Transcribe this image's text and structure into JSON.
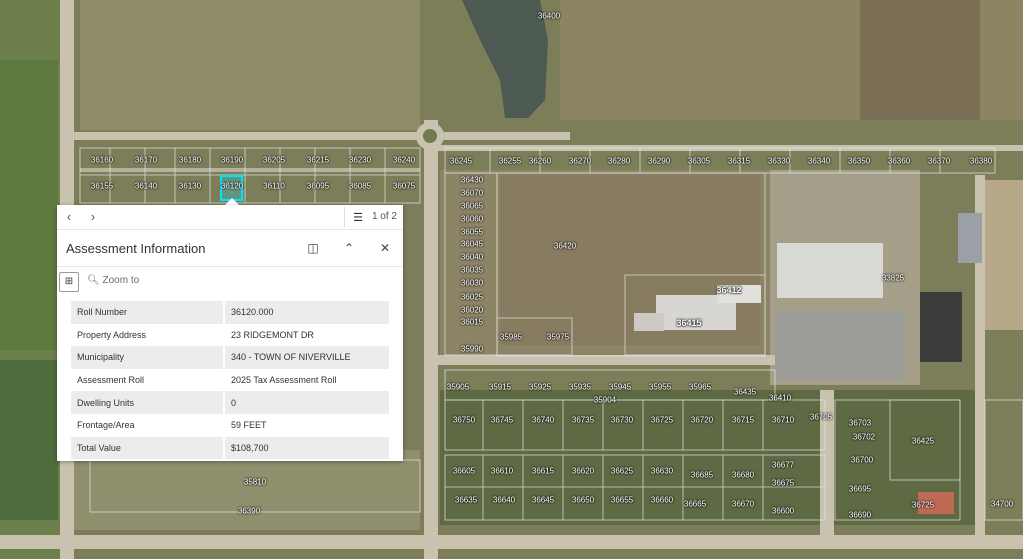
{
  "map": {
    "parcels": [
      "36400",
      "36160",
      "36170",
      "36180",
      "36190",
      "36205",
      "36215",
      "36230",
      "36240",
      "36155",
      "36140",
      "36130",
      "36120",
      "36110",
      "36095",
      "36085",
      "36075",
      "36245",
      "36255",
      "36260",
      "36270",
      "36280",
      "36290",
      "36305",
      "36315",
      "36330",
      "36340",
      "36350",
      "36360",
      "36370",
      "36380",
      "36430",
      "36070",
      "36065",
      "36060",
      "36055",
      "36045",
      "36040",
      "36035",
      "36030",
      "36025",
      "36020",
      "36015",
      "35990",
      "36420",
      "36412",
      "36415",
      "33825",
      "35985",
      "35975",
      "35905",
      "35915",
      "35925",
      "35935",
      "35945",
      "35955",
      "35965",
      "36435",
      "35904",
      "36410",
      "36750",
      "36745",
      "36740",
      "36735",
      "36730",
      "36725",
      "36720",
      "36715",
      "36710",
      "36705",
      "36703",
      "36702",
      "36425",
      "36700",
      "36605",
      "36610",
      "36615",
      "36620",
      "36625",
      "36630",
      "36685",
      "36680",
      "36677",
      "36675",
      "36635",
      "36640",
      "36645",
      "36650",
      "36655",
      "36660",
      "36665",
      "36670",
      "36600",
      "36695",
      "36690",
      "36725",
      "34700",
      "35810",
      "36390"
    ]
  },
  "popup": {
    "page_count": "1 of 2",
    "title": "Assessment Information",
    "zoom_label": "Zoom to",
    "fields": [
      {
        "key": "Roll Number",
        "value": "36120.000"
      },
      {
        "key": "Property Address",
        "value": "23 RIDGEMONT DR"
      },
      {
        "key": "Municipality",
        "value": "340 - TOWN OF NIVERVILLE"
      },
      {
        "key": "Assessment Roll",
        "value": "2025 Tax Assessment Roll"
      },
      {
        "key": "Dwelling Units",
        "value": "0"
      },
      {
        "key": "Frontage/Area",
        "value": "59 FEET"
      },
      {
        "key": "Total Value",
        "value": "$108,700"
      }
    ]
  },
  "colors": {
    "highlight": "#00e5ff",
    "road": "#c9c2ae",
    "field": "#7d7f58"
  }
}
